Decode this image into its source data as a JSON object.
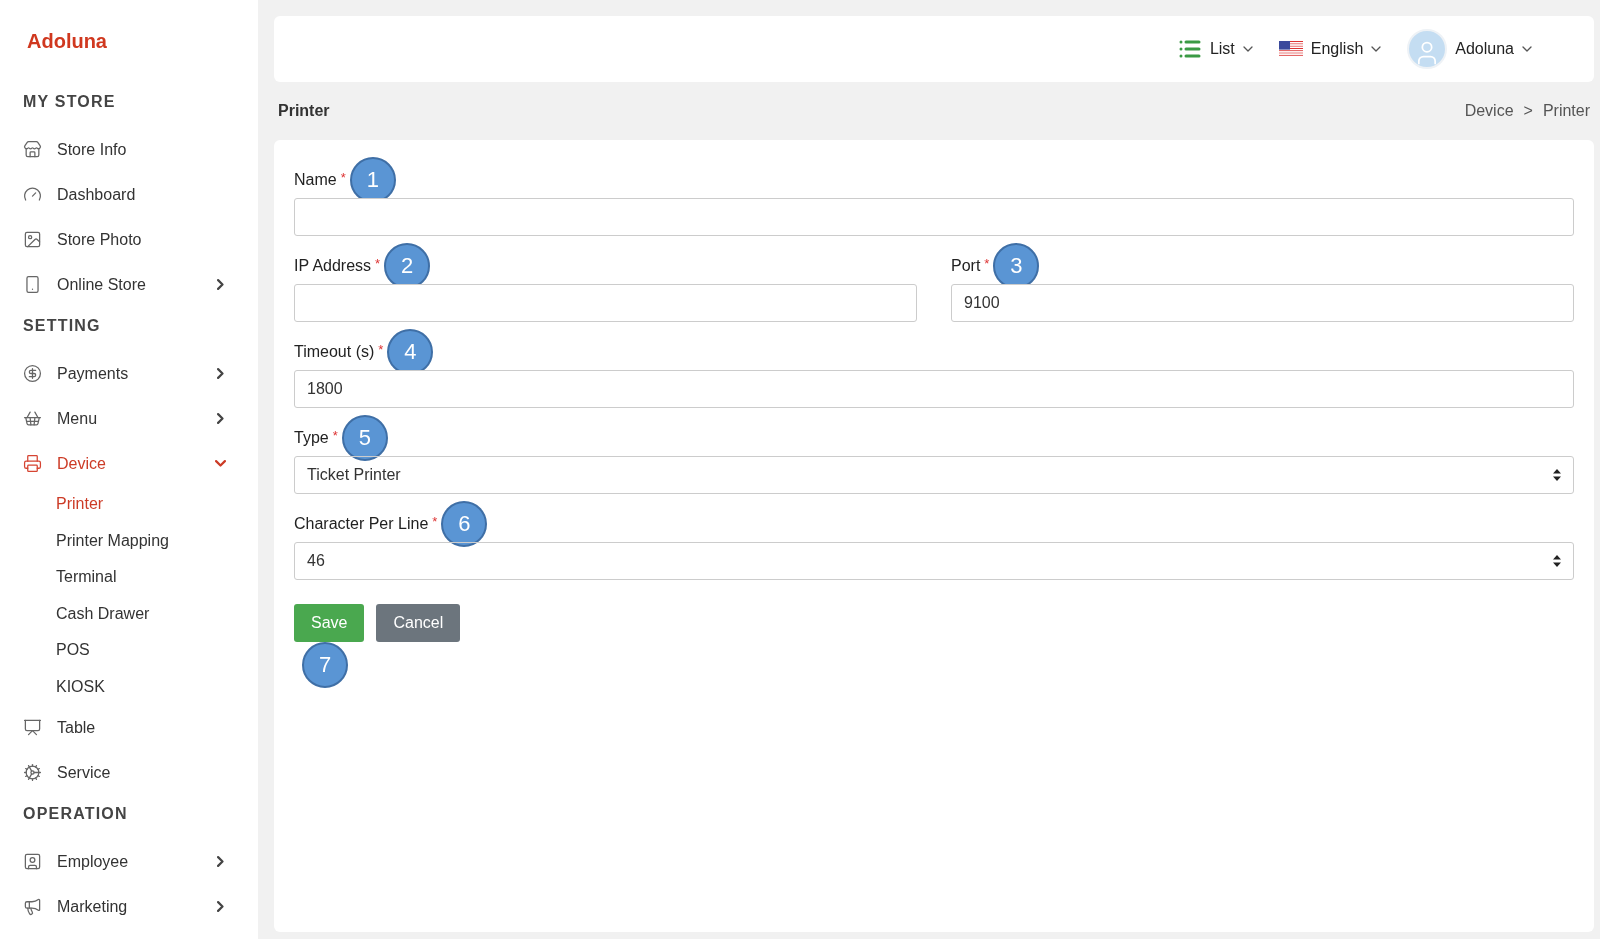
{
  "sidebar": {
    "logo": "Adoluna",
    "sections": [
      {
        "title": "MY STORE",
        "items": [
          {
            "label": "Store Info",
            "kind": "store",
            "selected": false
          },
          {
            "label": "Dashboard",
            "kind": "gauge",
            "selected": false
          },
          {
            "label": "Store Photo",
            "kind": "image",
            "selected": false
          },
          {
            "label": "Online Store",
            "kind": "phone",
            "selected": false,
            "expanded": false
          }
        ]
      },
      {
        "title": "SETTING",
        "items": [
          {
            "label": "Payments",
            "kind": "dollar",
            "selected": false,
            "expanded": false
          },
          {
            "label": "Menu",
            "kind": "basket",
            "selected": false,
            "expanded": false
          },
          {
            "label": "Device",
            "kind": "printer",
            "selected": true,
            "expanded": true,
            "children": [
              {
                "label": "Printer",
                "selected": true
              },
              {
                "label": "Printer Mapping",
                "selected": false
              },
              {
                "label": "Terminal",
                "selected": false
              },
              {
                "label": "Cash Drawer",
                "selected": false
              },
              {
                "label": "POS",
                "selected": false
              },
              {
                "label": "KIOSK",
                "selected": false
              }
            ]
          },
          {
            "label": "Table",
            "kind": "easel",
            "selected": false
          },
          {
            "label": "Service",
            "kind": "cog",
            "selected": false
          }
        ]
      },
      {
        "title": "OPERATION",
        "items": [
          {
            "label": "Employee",
            "kind": "badge",
            "selected": false,
            "expanded": false
          },
          {
            "label": "Marketing",
            "kind": "megaphone",
            "selected": false,
            "expanded": false
          }
        ]
      }
    ]
  },
  "header": {
    "menus": [
      {
        "label": "List",
        "kind": "list"
      },
      {
        "label": "English",
        "kind": "flag"
      },
      {
        "label": "Adoluna",
        "kind": "avatar"
      }
    ]
  },
  "page": {
    "title": "Printer",
    "breadcrumb": [
      "Device",
      "Printer"
    ],
    "separator": ">"
  },
  "form": {
    "rows": [
      [
        {
          "label": "Name",
          "required_mark": "*",
          "kind": "input",
          "marker": "1"
        }
      ],
      [
        {
          "label": "IP Address",
          "required_mark": "*",
          "kind": "input",
          "marker": "2"
        },
        {
          "label": "Port",
          "required_mark": "*",
          "kind": "input",
          "value": "9100",
          "marker": "3"
        }
      ],
      [
        {
          "label": "Timeout (s)",
          "required_mark": "*",
          "kind": "input",
          "value": "1800",
          "marker": "4"
        }
      ],
      [
        {
          "label": "Type",
          "required_mark": "*",
          "kind": "select",
          "value": "Ticket Printer",
          "marker": "5"
        }
      ],
      [
        {
          "label": "Character Per Line",
          "required_mark": "*",
          "kind": "select",
          "value": "46",
          "marker": "6"
        }
      ]
    ],
    "buttons": [
      {
        "label": "Save",
        "kind": "primary"
      },
      {
        "label": "Cancel",
        "kind": "secondary"
      }
    ],
    "buttons_marker": "7"
  }
}
